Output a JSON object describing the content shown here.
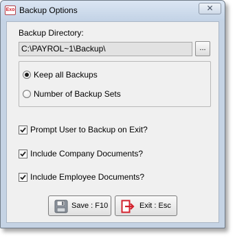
{
  "window": {
    "title": "Backup Options",
    "app_icon_text": "Exo",
    "close_glyph": "✕"
  },
  "backup_directory": {
    "label": "Backup Directory:",
    "value": "C:\\PAYROL~1\\Backup\\",
    "browse_label": "..."
  },
  "backup_mode": {
    "options": [
      {
        "label": "Keep all Backups",
        "selected": true
      },
      {
        "label": "Number of Backup Sets",
        "selected": false
      }
    ]
  },
  "options": [
    {
      "label": "Prompt User to Backup on Exit?",
      "checked": true
    },
    {
      "label": "Include Company Documents?",
      "checked": true
    },
    {
      "label": "Include Employee Documents?",
      "checked": true
    }
  ],
  "buttons": {
    "save": {
      "label": "Save : F10",
      "icon": "floppy-disk-icon"
    },
    "exit": {
      "label": "Exit : Esc",
      "icon": "exit-door-icon"
    }
  },
  "colors": {
    "accent_red": "#d3202c"
  }
}
